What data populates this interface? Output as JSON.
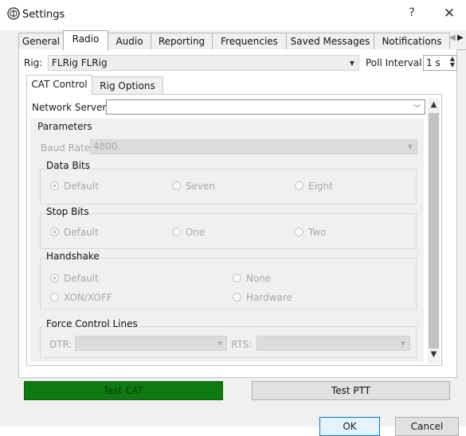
{
  "window": {
    "title": "Settings",
    "help_label": "?",
    "close_label": "✕"
  },
  "tabs": [
    "General",
    "Radio",
    "Audio",
    "Reporting",
    "Frequencies",
    "Saved Messages",
    "Notifications"
  ],
  "tabs_scroll": {
    "left": "◀",
    "right": "▶"
  },
  "rig": {
    "label": "Rig:",
    "value": "FLRig FLRig",
    "poll_label": "Poll Interval:",
    "poll_value": "1 s"
  },
  "inner_tabs": [
    "CAT Control",
    "Rig Options"
  ],
  "network_server": {
    "label": "Network Server:",
    "value": ""
  },
  "parameters": {
    "title": "Parameters",
    "baud_label": "Baud Rate:",
    "baud_value": "4800",
    "data_bits": {
      "title": "Data Bits",
      "options": [
        "Default",
        "Seven",
        "Eight"
      ],
      "selected": "Default"
    },
    "stop_bits": {
      "title": "Stop Bits",
      "options": [
        "Default",
        "One",
        "Two"
      ],
      "selected": "Default"
    },
    "handshake": {
      "title": "Handshake",
      "options": [
        "Default",
        "None",
        "XON/XOFF",
        "Hardware"
      ],
      "selected": "Default"
    },
    "force_control": {
      "title": "Force Control Lines",
      "dtr_label": "DTR:",
      "rts_label": "RTS:"
    }
  },
  "buttons": {
    "test_cat": "Test CAT",
    "test_ptt": "Test PTT",
    "ok": "OK",
    "cancel": "Cancel"
  },
  "colors": {
    "test_cat_bg": "#0f7a10",
    "accent": "#0078d7"
  }
}
